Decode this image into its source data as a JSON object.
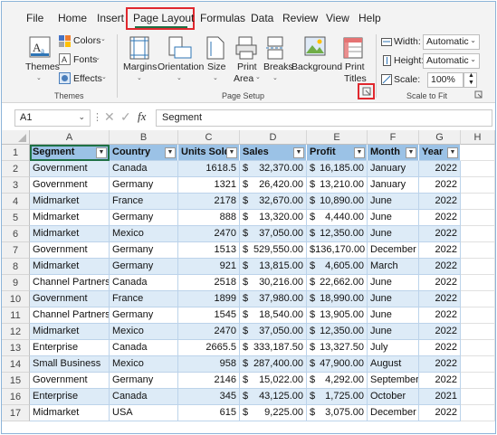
{
  "menu": {
    "tabs": [
      "File",
      "Home",
      "Insert",
      "Page Layout",
      "Formulas",
      "Data",
      "Review",
      "View",
      "Help"
    ],
    "active_tab": "Page Layout"
  },
  "ribbon": {
    "themes": {
      "button": "Themes",
      "colors": "Colors",
      "fonts": "Fonts",
      "effects": "Effects",
      "group": "Themes"
    },
    "page_setup": {
      "margins": "Margins",
      "orientation": "Orientation",
      "size": "Size",
      "print_area_1": "Print",
      "print_area_2": "Area",
      "breaks": "Breaks",
      "background": "Background",
      "print_titles_1": "Print",
      "print_titles_2": "Titles",
      "group": "Page Setup"
    },
    "scale": {
      "width_label": "Width:",
      "width_value": "Automatic",
      "height_label": "Height:",
      "height_value": "Automatic",
      "scale_label": "Scale:",
      "scale_value": "100%",
      "group": "Scale to Fit"
    }
  },
  "formula_bar": {
    "name_box": "A1",
    "fx": "fx",
    "content": "Segment"
  },
  "grid": {
    "columns": [
      "A",
      "B",
      "C",
      "D",
      "E",
      "F",
      "G",
      "H"
    ],
    "headers": [
      "Segment",
      "Country",
      "Units Sold",
      "Sales",
      "Profit",
      "Month",
      "Year"
    ],
    "rows": [
      [
        "Government",
        "Canada",
        "1618.5",
        "32,370.00",
        "16,185.00",
        "January",
        "2022"
      ],
      [
        "Government",
        "Germany",
        "1321",
        "26,420.00",
        "13,210.00",
        "January",
        "2022"
      ],
      [
        "Midmarket",
        "France",
        "2178",
        "32,670.00",
        "10,890.00",
        "June",
        "2022"
      ],
      [
        "Midmarket",
        "Germany",
        "888",
        "13,320.00",
        "4,440.00",
        "June",
        "2022"
      ],
      [
        "Midmarket",
        "Mexico",
        "2470",
        "37,050.00",
        "12,350.00",
        "June",
        "2022"
      ],
      [
        "Government",
        "Germany",
        "1513",
        "529,550.00",
        "136,170.00",
        "December",
        "2022"
      ],
      [
        "Midmarket",
        "Germany",
        "921",
        "13,815.00",
        "4,605.00",
        "March",
        "2022"
      ],
      [
        "Channel Partners",
        "Canada",
        "2518",
        "30,216.00",
        "22,662.00",
        "June",
        "2022"
      ],
      [
        "Government",
        "France",
        "1899",
        "37,980.00",
        "18,990.00",
        "June",
        "2022"
      ],
      [
        "Channel Partners",
        "Germany",
        "1545",
        "18,540.00",
        "13,905.00",
        "June",
        "2022"
      ],
      [
        "Midmarket",
        "Mexico",
        "2470",
        "37,050.00",
        "12,350.00",
        "June",
        "2022"
      ],
      [
        "Enterprise",
        "Canada",
        "2665.5",
        "333,187.50",
        "13,327.50",
        "July",
        "2022"
      ],
      [
        "Small Business",
        "Mexico",
        "958",
        "287,400.00",
        "47,900.00",
        "August",
        "2022"
      ],
      [
        "Government",
        "Germany",
        "2146",
        "15,022.00",
        "4,292.00",
        "September",
        "2022"
      ],
      [
        "Enterprise",
        "Canada",
        "345",
        "43,125.00",
        "1,725.00",
        "October",
        "2021"
      ],
      [
        "Midmarket",
        "USA",
        "615",
        "9,225.00",
        "3,075.00",
        "December",
        "2022"
      ]
    ],
    "currency_symbol": "$"
  },
  "colors": {
    "header_fill": "#9bc2e6",
    "band_fill": "#ddebf7",
    "highlight_box": "#e0282e",
    "active_tab_underline": "#1e7145"
  },
  "icons": [
    "themes-icon",
    "colors-icon",
    "fonts-icon",
    "effects-icon",
    "margins-icon",
    "orientation-icon",
    "size-icon",
    "print-area-icon",
    "breaks-icon",
    "background-icon",
    "print-titles-icon",
    "width-icon",
    "height-icon",
    "scale-icon",
    "dialog-launcher-icon",
    "filter-dropdown-icon"
  ]
}
